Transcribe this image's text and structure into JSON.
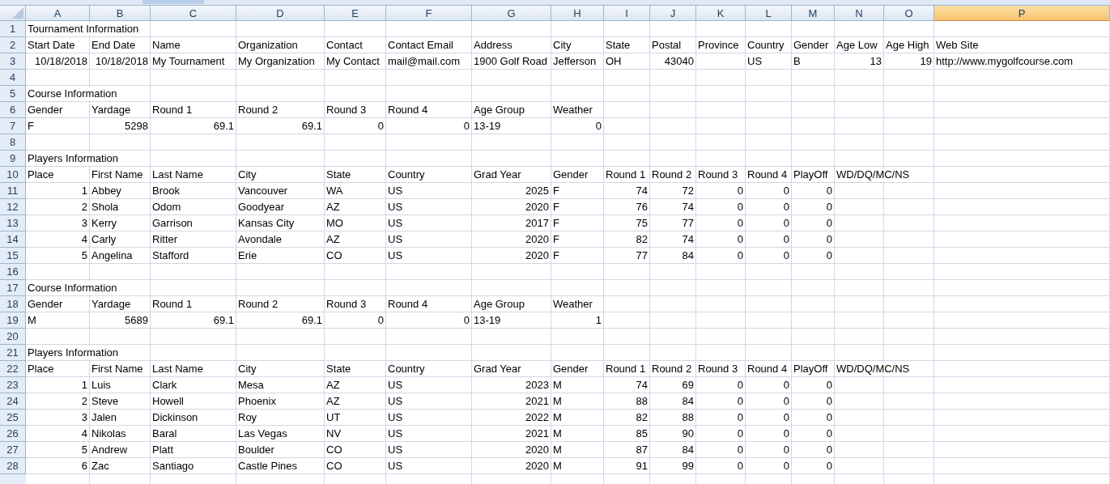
{
  "columns": [
    {
      "label": "A",
      "selected": false
    },
    {
      "label": "B",
      "selected": false
    },
    {
      "label": "C",
      "selected": false
    },
    {
      "label": "D",
      "selected": false
    },
    {
      "label": "E",
      "selected": false
    },
    {
      "label": "F",
      "selected": false
    },
    {
      "label": "G",
      "selected": false
    },
    {
      "label": "H",
      "selected": false
    },
    {
      "label": "I",
      "selected": false
    },
    {
      "label": "J",
      "selected": false
    },
    {
      "label": "K",
      "selected": false
    },
    {
      "label": "L",
      "selected": false
    },
    {
      "label": "M",
      "selected": false
    },
    {
      "label": "N",
      "selected": false
    },
    {
      "label": "O",
      "selected": false
    },
    {
      "label": "P",
      "selected": true
    }
  ],
  "rows": [
    {
      "number": "1",
      "cells": [
        {
          "text": "Tournament Information",
          "kind": "text"
        }
      ]
    },
    {
      "number": "2",
      "cells": [
        {
          "text": "Start Date",
          "kind": "text"
        },
        {
          "text": "End Date",
          "kind": "text"
        },
        {
          "text": "Name",
          "kind": "text"
        },
        {
          "text": "Organization",
          "kind": "text"
        },
        {
          "text": "Contact",
          "kind": "text"
        },
        {
          "text": "Contact Email",
          "kind": "text"
        },
        {
          "text": "Address",
          "kind": "text"
        },
        {
          "text": "City",
          "kind": "text"
        },
        {
          "text": "State",
          "kind": "text"
        },
        {
          "text": "Postal",
          "kind": "text"
        },
        {
          "text": "Province",
          "kind": "text"
        },
        {
          "text": "Country",
          "kind": "text"
        },
        {
          "text": "Gender",
          "kind": "text"
        },
        {
          "text": "Age Low",
          "kind": "text"
        },
        {
          "text": "Age High",
          "kind": "text"
        },
        {
          "text": "Web Site",
          "kind": "text"
        }
      ]
    },
    {
      "number": "3",
      "cells": [
        {
          "text": "10/18/2018",
          "kind": "number"
        },
        {
          "text": "10/18/2018",
          "kind": "number"
        },
        {
          "text": "My Tournament",
          "kind": "text"
        },
        {
          "text": "My Organization",
          "kind": "text"
        },
        {
          "text": "My Contact",
          "kind": "text"
        },
        {
          "text": "mail@mail.com",
          "kind": "text"
        },
        {
          "text": "1900 Golf Road",
          "kind": "text"
        },
        {
          "text": "Jefferson",
          "kind": "text"
        },
        {
          "text": "OH",
          "kind": "text"
        },
        {
          "text": "43040",
          "kind": "number"
        },
        null,
        {
          "text": "US",
          "kind": "text"
        },
        {
          "text": "B",
          "kind": "text"
        },
        {
          "text": "13",
          "kind": "number"
        },
        {
          "text": "19",
          "kind": "number"
        },
        {
          "text": "http://www.mygolfcourse.com",
          "kind": "text"
        }
      ]
    },
    {
      "number": "4",
      "cells": []
    },
    {
      "number": "5",
      "cells": [
        {
          "text": "Course Information",
          "kind": "text"
        }
      ]
    },
    {
      "number": "6",
      "cells": [
        {
          "text": "Gender",
          "kind": "text"
        },
        {
          "text": "Yardage",
          "kind": "text"
        },
        {
          "text": "Round 1",
          "kind": "text"
        },
        {
          "text": "Round 2",
          "kind": "text"
        },
        {
          "text": "Round 3",
          "kind": "text"
        },
        {
          "text": "Round 4",
          "kind": "text"
        },
        {
          "text": "Age Group",
          "kind": "text"
        },
        {
          "text": "Weather",
          "kind": "text"
        }
      ]
    },
    {
      "number": "7",
      "cells": [
        {
          "text": "F",
          "kind": "text"
        },
        {
          "text": "5298",
          "kind": "number"
        },
        {
          "text": "69.1",
          "kind": "number"
        },
        {
          "text": "69.1",
          "kind": "number"
        },
        {
          "text": "0",
          "kind": "number"
        },
        {
          "text": "0",
          "kind": "number"
        },
        {
          "text": "13-19",
          "kind": "text"
        },
        {
          "text": "0",
          "kind": "number"
        }
      ]
    },
    {
      "number": "8",
      "cells": []
    },
    {
      "number": "9",
      "cells": [
        {
          "text": "Players Information",
          "kind": "text"
        }
      ]
    },
    {
      "number": "10",
      "cells": [
        {
          "text": "Place",
          "kind": "text"
        },
        {
          "text": "First Name",
          "kind": "text"
        },
        {
          "text": "Last Name",
          "kind": "text"
        },
        {
          "text": "City",
          "kind": "text"
        },
        {
          "text": "State",
          "kind": "text"
        },
        {
          "text": "Country",
          "kind": "text"
        },
        {
          "text": "Grad Year",
          "kind": "text"
        },
        {
          "text": "Gender",
          "kind": "text"
        },
        {
          "text": "Round 1",
          "kind": "text"
        },
        {
          "text": "Round 2",
          "kind": "text"
        },
        {
          "text": "Round 3",
          "kind": "text"
        },
        {
          "text": "Round 4",
          "kind": "text"
        },
        {
          "text": "PlayOff",
          "kind": "text"
        },
        {
          "text": "WD/DQ/MC/NS",
          "kind": "text"
        }
      ]
    },
    {
      "number": "11",
      "cells": [
        {
          "text": "1",
          "kind": "number"
        },
        {
          "text": "Abbey",
          "kind": "text"
        },
        {
          "text": "Brook",
          "kind": "text"
        },
        {
          "text": "Vancouver",
          "kind": "text"
        },
        {
          "text": "WA",
          "kind": "text"
        },
        {
          "text": "US",
          "kind": "text"
        },
        {
          "text": "2025",
          "kind": "number"
        },
        {
          "text": "F",
          "kind": "text"
        },
        {
          "text": "74",
          "kind": "number"
        },
        {
          "text": "72",
          "kind": "number"
        },
        {
          "text": "0",
          "kind": "number"
        },
        {
          "text": "0",
          "kind": "number"
        },
        {
          "text": "0",
          "kind": "number"
        }
      ]
    },
    {
      "number": "12",
      "cells": [
        {
          "text": "2",
          "kind": "number"
        },
        {
          "text": "Shola",
          "kind": "text"
        },
        {
          "text": "Odom",
          "kind": "text"
        },
        {
          "text": "Goodyear",
          "kind": "text"
        },
        {
          "text": "AZ",
          "kind": "text"
        },
        {
          "text": "US",
          "kind": "text"
        },
        {
          "text": "2020",
          "kind": "number"
        },
        {
          "text": "F",
          "kind": "text"
        },
        {
          "text": "76",
          "kind": "number"
        },
        {
          "text": "74",
          "kind": "number"
        },
        {
          "text": "0",
          "kind": "number"
        },
        {
          "text": "0",
          "kind": "number"
        },
        {
          "text": "0",
          "kind": "number"
        }
      ]
    },
    {
      "number": "13",
      "cells": [
        {
          "text": "3",
          "kind": "number"
        },
        {
          "text": "Kerry",
          "kind": "text"
        },
        {
          "text": "Garrison",
          "kind": "text"
        },
        {
          "text": "Kansas City",
          "kind": "text"
        },
        {
          "text": "MO",
          "kind": "text"
        },
        {
          "text": "US",
          "kind": "text"
        },
        {
          "text": "2017",
          "kind": "number"
        },
        {
          "text": "F",
          "kind": "text"
        },
        {
          "text": "75",
          "kind": "number"
        },
        {
          "text": "77",
          "kind": "number"
        },
        {
          "text": "0",
          "kind": "number"
        },
        {
          "text": "0",
          "kind": "number"
        },
        {
          "text": "0",
          "kind": "number"
        }
      ]
    },
    {
      "number": "14",
      "cells": [
        {
          "text": "4",
          "kind": "number"
        },
        {
          "text": "Carly",
          "kind": "text"
        },
        {
          "text": "Ritter",
          "kind": "text"
        },
        {
          "text": "Avondale",
          "kind": "text"
        },
        {
          "text": "AZ",
          "kind": "text"
        },
        {
          "text": "US",
          "kind": "text"
        },
        {
          "text": "2020",
          "kind": "number"
        },
        {
          "text": "F",
          "kind": "text"
        },
        {
          "text": "82",
          "kind": "number"
        },
        {
          "text": "74",
          "kind": "number"
        },
        {
          "text": "0",
          "kind": "number"
        },
        {
          "text": "0",
          "kind": "number"
        },
        {
          "text": "0",
          "kind": "number"
        }
      ]
    },
    {
      "number": "15",
      "cells": [
        {
          "text": "5",
          "kind": "number"
        },
        {
          "text": "Angelina",
          "kind": "text"
        },
        {
          "text": "Stafford",
          "kind": "text"
        },
        {
          "text": "Erie",
          "kind": "text"
        },
        {
          "text": "CO",
          "kind": "text"
        },
        {
          "text": "US",
          "kind": "text"
        },
        {
          "text": "2020",
          "kind": "number"
        },
        {
          "text": "F",
          "kind": "text"
        },
        {
          "text": "77",
          "kind": "number"
        },
        {
          "text": "84",
          "kind": "number"
        },
        {
          "text": "0",
          "kind": "number"
        },
        {
          "text": "0",
          "kind": "number"
        },
        {
          "text": "0",
          "kind": "number"
        }
      ]
    },
    {
      "number": "16",
      "cells": []
    },
    {
      "number": "17",
      "cells": [
        {
          "text": "Course Information",
          "kind": "text"
        }
      ]
    },
    {
      "number": "18",
      "cells": [
        {
          "text": "Gender",
          "kind": "text"
        },
        {
          "text": "Yardage",
          "kind": "text"
        },
        {
          "text": "Round 1",
          "kind": "text"
        },
        {
          "text": "Round 2",
          "kind": "text"
        },
        {
          "text": "Round 3",
          "kind": "text"
        },
        {
          "text": "Round 4",
          "kind": "text"
        },
        {
          "text": "Age Group",
          "kind": "text"
        },
        {
          "text": "Weather",
          "kind": "text"
        }
      ]
    },
    {
      "number": "19",
      "cells": [
        {
          "text": "M",
          "kind": "text"
        },
        {
          "text": "5689",
          "kind": "number"
        },
        {
          "text": "69.1",
          "kind": "number"
        },
        {
          "text": "69.1",
          "kind": "number"
        },
        {
          "text": "0",
          "kind": "number"
        },
        {
          "text": "0",
          "kind": "number"
        },
        {
          "text": "13-19",
          "kind": "text"
        },
        {
          "text": "1",
          "kind": "number"
        }
      ]
    },
    {
      "number": "20",
      "cells": []
    },
    {
      "number": "21",
      "cells": [
        {
          "text": "Players Information",
          "kind": "text"
        }
      ]
    },
    {
      "number": "22",
      "cells": [
        {
          "text": "Place",
          "kind": "text"
        },
        {
          "text": "First Name",
          "kind": "text"
        },
        {
          "text": "Last Name",
          "kind": "text"
        },
        {
          "text": "City",
          "kind": "text"
        },
        {
          "text": "State",
          "kind": "text"
        },
        {
          "text": "Country",
          "kind": "text"
        },
        {
          "text": "Grad Year",
          "kind": "text"
        },
        {
          "text": "Gender",
          "kind": "text"
        },
        {
          "text": "Round 1",
          "kind": "text"
        },
        {
          "text": "Round 2",
          "kind": "text"
        },
        {
          "text": "Round 3",
          "kind": "text"
        },
        {
          "text": "Round 4",
          "kind": "text"
        },
        {
          "text": "PlayOff",
          "kind": "text"
        },
        {
          "text": "WD/DQ/MC/NS",
          "kind": "text"
        }
      ]
    },
    {
      "number": "23",
      "cells": [
        {
          "text": "1",
          "kind": "number"
        },
        {
          "text": "Luis",
          "kind": "text"
        },
        {
          "text": "Clark",
          "kind": "text"
        },
        {
          "text": "Mesa",
          "kind": "text"
        },
        {
          "text": "AZ",
          "kind": "text"
        },
        {
          "text": "US",
          "kind": "text"
        },
        {
          "text": "2023",
          "kind": "number"
        },
        {
          "text": "M",
          "kind": "text"
        },
        {
          "text": "74",
          "kind": "number"
        },
        {
          "text": "69",
          "kind": "number"
        },
        {
          "text": "0",
          "kind": "number"
        },
        {
          "text": "0",
          "kind": "number"
        },
        {
          "text": "0",
          "kind": "number"
        }
      ]
    },
    {
      "number": "24",
      "cells": [
        {
          "text": "2",
          "kind": "number"
        },
        {
          "text": "Steve",
          "kind": "text"
        },
        {
          "text": "Howell",
          "kind": "text"
        },
        {
          "text": "Phoenix",
          "kind": "text"
        },
        {
          "text": "AZ",
          "kind": "text"
        },
        {
          "text": "US",
          "kind": "text"
        },
        {
          "text": "2021",
          "kind": "number"
        },
        {
          "text": "M",
          "kind": "text"
        },
        {
          "text": "88",
          "kind": "number"
        },
        {
          "text": "84",
          "kind": "number"
        },
        {
          "text": "0",
          "kind": "number"
        },
        {
          "text": "0",
          "kind": "number"
        },
        {
          "text": "0",
          "kind": "number"
        }
      ]
    },
    {
      "number": "25",
      "cells": [
        {
          "text": "3",
          "kind": "number"
        },
        {
          "text": "Jalen",
          "kind": "text"
        },
        {
          "text": "Dickinson",
          "kind": "text"
        },
        {
          "text": "Roy",
          "kind": "text"
        },
        {
          "text": "UT",
          "kind": "text"
        },
        {
          "text": "US",
          "kind": "text"
        },
        {
          "text": "2022",
          "kind": "number"
        },
        {
          "text": "M",
          "kind": "text"
        },
        {
          "text": "82",
          "kind": "number"
        },
        {
          "text": "88",
          "kind": "number"
        },
        {
          "text": "0",
          "kind": "number"
        },
        {
          "text": "0",
          "kind": "number"
        },
        {
          "text": "0",
          "kind": "number"
        }
      ]
    },
    {
      "number": "26",
      "cells": [
        {
          "text": "4",
          "kind": "number"
        },
        {
          "text": "Nikolas",
          "kind": "text"
        },
        {
          "text": "Baral",
          "kind": "text"
        },
        {
          "text": "Las Vegas",
          "kind": "text"
        },
        {
          "text": "NV",
          "kind": "text"
        },
        {
          "text": "US",
          "kind": "text"
        },
        {
          "text": "2021",
          "kind": "number"
        },
        {
          "text": "M",
          "kind": "text"
        },
        {
          "text": "85",
          "kind": "number"
        },
        {
          "text": "90",
          "kind": "number"
        },
        {
          "text": "0",
          "kind": "number"
        },
        {
          "text": "0",
          "kind": "number"
        },
        {
          "text": "0",
          "kind": "number"
        }
      ]
    },
    {
      "number": "27",
      "cells": [
        {
          "text": "5",
          "kind": "number"
        },
        {
          "text": "Andrew",
          "kind": "text"
        },
        {
          "text": "Platt",
          "kind": "text"
        },
        {
          "text": "Boulder",
          "kind": "text"
        },
        {
          "text": "CO",
          "kind": "text"
        },
        {
          "text": "US",
          "kind": "text"
        },
        {
          "text": "2020",
          "kind": "number"
        },
        {
          "text": "M",
          "kind": "text"
        },
        {
          "text": "87",
          "kind": "number"
        },
        {
          "text": "84",
          "kind": "number"
        },
        {
          "text": "0",
          "kind": "number"
        },
        {
          "text": "0",
          "kind": "number"
        },
        {
          "text": "0",
          "kind": "number"
        }
      ]
    },
    {
      "number": "28",
      "cells": [
        {
          "text": "6",
          "kind": "number"
        },
        {
          "text": "Zac",
          "kind": "text"
        },
        {
          "text": "Santiago",
          "kind": "text"
        },
        {
          "text": "Castle Pines",
          "kind": "text"
        },
        {
          "text": "CO",
          "kind": "text"
        },
        {
          "text": "US",
          "kind": "text"
        },
        {
          "text": "2020",
          "kind": "number"
        },
        {
          "text": "M",
          "kind": "text"
        },
        {
          "text": "91",
          "kind": "number"
        },
        {
          "text": "99",
          "kind": "number"
        },
        {
          "text": "0",
          "kind": "number"
        },
        {
          "text": "0",
          "kind": "number"
        },
        {
          "text": "0",
          "kind": "number"
        }
      ]
    }
  ]
}
